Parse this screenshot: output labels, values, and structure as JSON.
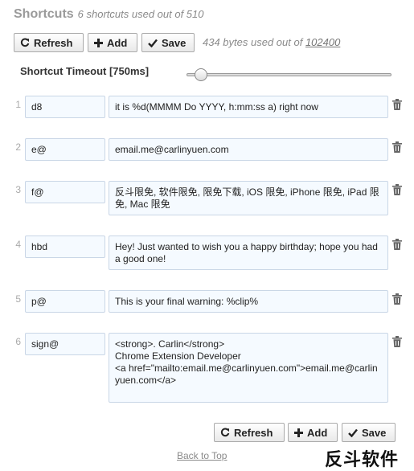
{
  "header": {
    "title": "Shortcuts",
    "subtitle": "6 shortcuts used out of 510"
  },
  "toolbar": {
    "refresh_label": "Refresh",
    "add_label": "Add",
    "save_label": "Save",
    "bytes_prefix": "434 bytes used out of ",
    "bytes_limit": "102400"
  },
  "timeout": {
    "label": "Shortcut Timeout [750ms]",
    "level_percent": 4
  },
  "shortcuts": [
    {
      "num": "1",
      "key": "d8",
      "value": "it is %d(MMMM Do YYYY, h:mm:ss a) right now"
    },
    {
      "num": "2",
      "key": "e@",
      "value": "email.me@carlinyuen.com"
    },
    {
      "num": "3",
      "key": "f@",
      "value": "反斗限免, 软件限免, 限免下载, iOS 限免, iPhone 限免, iPad 限免, Mac 限免"
    },
    {
      "num": "4",
      "key": "hbd",
      "value": "Hey! Just wanted to wish you a happy birthday; hope you had a good one!"
    },
    {
      "num": "5",
      "key": "p@",
      "value": "This is your final warning: %clip%"
    },
    {
      "num": "6",
      "key": "sign@",
      "value": "<strong>. Carlin</strong>\nChrome Extension Developer\n<a href=\"mailto:email.me@carlinyuen.com\">email.me@carlinyuen.com</a>"
    }
  ],
  "footer": {
    "refresh_label": "Refresh",
    "add_label": "Add",
    "save_label": "Save",
    "back_to_top": "Back to Top"
  },
  "watermark": "反斗软件"
}
